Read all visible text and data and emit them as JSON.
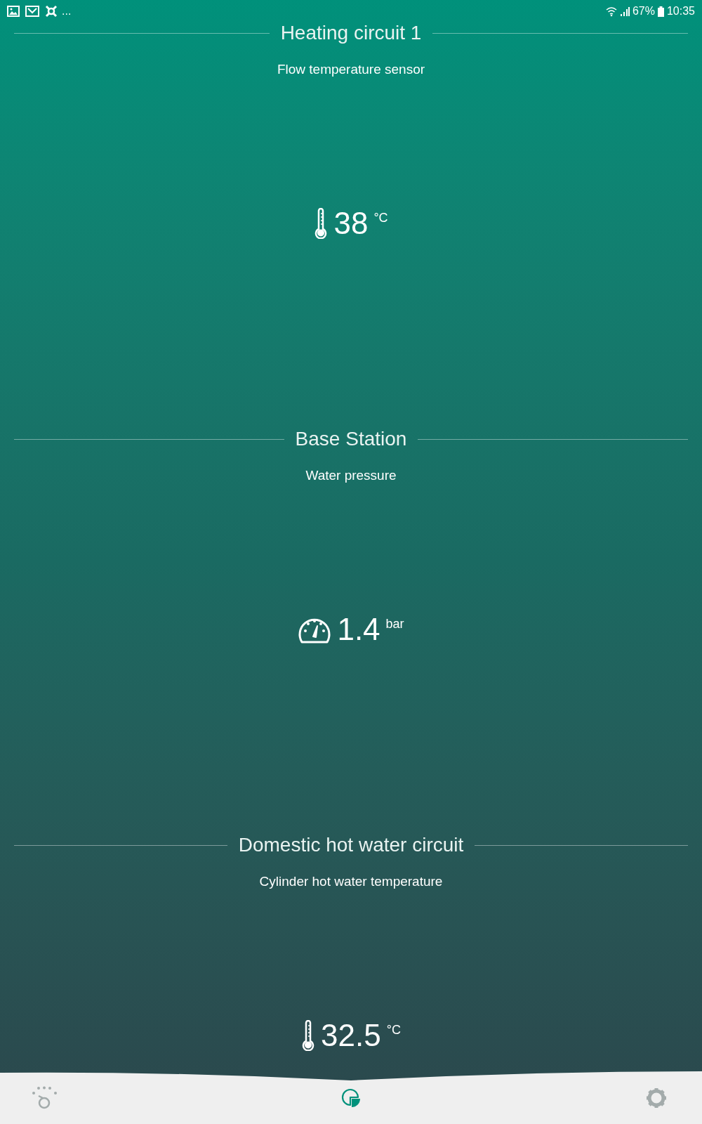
{
  "status_bar": {
    "overflow": "...",
    "battery": "67%",
    "time": "10:35"
  },
  "sections": [
    {
      "title": "Heating circuit 1",
      "label": "Flow temperature sensor",
      "kind": "temperature",
      "value": "38",
      "unit": "°C"
    },
    {
      "title": "Base Station",
      "label": "Water pressure",
      "kind": "pressure",
      "value": "1.4",
      "unit": "bar"
    },
    {
      "title": "Domestic hot water circuit",
      "label": "Cylinder hot water temperature",
      "kind": "temperature",
      "value": "32.5",
      "unit": "°C"
    }
  ],
  "nav": [
    {
      "kind": "heating",
      "selected": false
    },
    {
      "kind": "chart",
      "selected": true
    },
    {
      "kind": "settings",
      "selected": false
    }
  ]
}
